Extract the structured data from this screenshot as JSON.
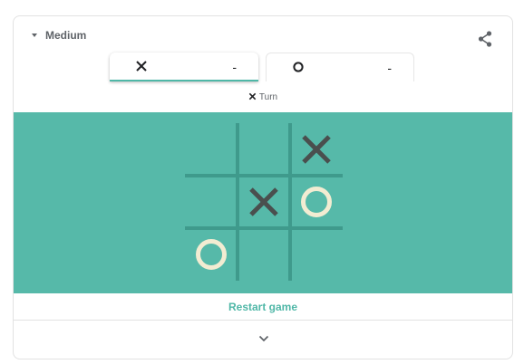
{
  "difficulty": {
    "label": "Medium"
  },
  "players": [
    {
      "mark": "X",
      "score": "-",
      "active": true
    },
    {
      "mark": "O",
      "score": "-",
      "active": false
    }
  ],
  "turn": {
    "mark": "X",
    "label": "Turn"
  },
  "board": {
    "cells": [
      [
        "",
        "",
        "X"
      ],
      [
        "",
        "X",
        "O"
      ],
      [
        "O",
        "",
        ""
      ]
    ]
  },
  "restart_label": "Restart game",
  "colors": {
    "board_background": "#56b9a9",
    "grid_line": "#3f9a8c",
    "x_mark": "#4a4f4e",
    "o_mark": "#f2ecd2",
    "accent": "#4fb7a7"
  },
  "icons": {
    "difficulty": "caret-down-icon",
    "share": "share-icon",
    "expand": "chevron-down-icon"
  }
}
